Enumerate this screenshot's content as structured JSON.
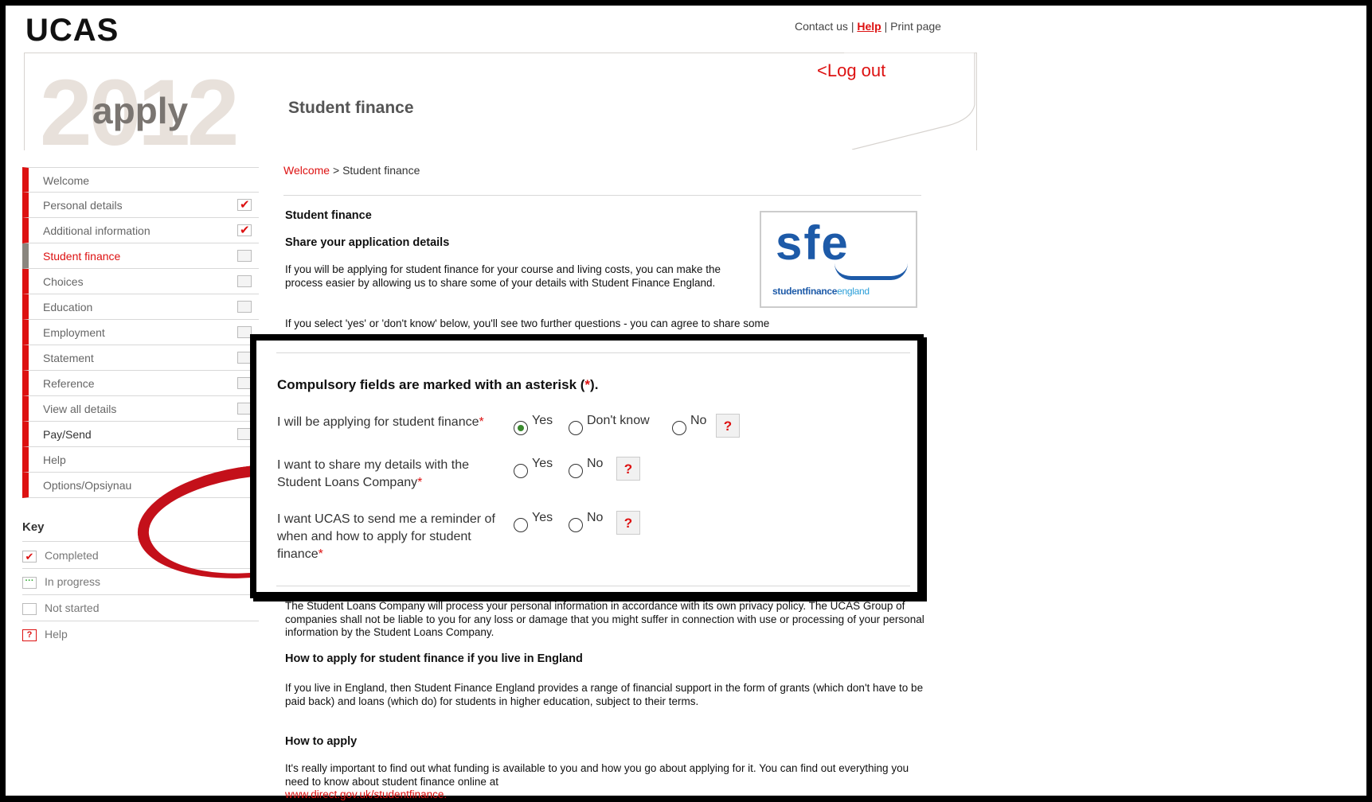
{
  "logo": "UCAS",
  "top_links": {
    "contact": "Contact us",
    "sep1": " | ",
    "help": "Help",
    "sep2": " | ",
    "print": "Print page"
  },
  "header": {
    "year": "2012",
    "product": "apply",
    "section": "Student finance",
    "logout": "<Log out"
  },
  "sidebar": {
    "items": [
      {
        "label": "Welcome",
        "status": "none"
      },
      {
        "label": "Personal details",
        "status": "completed"
      },
      {
        "label": "Additional information",
        "status": "completed"
      },
      {
        "label": "Student finance",
        "status": "not_started",
        "active": true
      },
      {
        "label": "Choices",
        "status": "not_started"
      },
      {
        "label": "Education",
        "status": "not_started"
      },
      {
        "label": "Employment",
        "status": "not_started"
      },
      {
        "label": "Statement",
        "status": "not_started"
      },
      {
        "label": "Reference",
        "status": "not_started"
      },
      {
        "label": "View all details",
        "status": "not_started"
      },
      {
        "label": "Pay/Send",
        "status": "not_started"
      },
      {
        "label": "Help",
        "status": "none"
      },
      {
        "label": "Options/Opsiynau",
        "status": "none"
      }
    ]
  },
  "key": {
    "title": "Key",
    "completed": "Completed",
    "in_progress": "In progress",
    "not_started": "Not started",
    "help": "Help"
  },
  "breadcrumb": {
    "home": "Welcome",
    "sep": " > ",
    "current": "Student finance"
  },
  "content": {
    "heading": "Student finance",
    "subheading": "Share your application details",
    "p1": "If you will be applying for student finance for your course and living costs, you can make the process easier by allowing us to share some of your details with Student Finance England.",
    "p2": "If you select 'yes' or 'don't know' below, you'll see two further questions - you can agree to share some",
    "p3": "The Student Loans Company will process your personal information in accordance with its own privacy policy. The UCAS Group of companies shall not be liable to you for any loss or damage that you might suffer in connection with use or processing of your personal information by the Student Loans Company.",
    "h_england": "How to apply for student finance if you live in England",
    "p4": "If you live in England, then Student Finance England provides a range of financial support in the form of grants (which don't have to be paid back) and loans (which do) for students in higher education, subject to their terms.",
    "h_how": "How to apply",
    "p5": "It's really important to find out what funding is available to you and how you go about applying for it. You can find out everything you need to know about student finance online at",
    "link": "www.direct.gov.uk/studentfinance."
  },
  "sfe_logo": {
    "big": "sfe",
    "small_a": "studentfinance",
    "small_b": "england"
  },
  "form": {
    "title_prefix": "Compulsory fields are marked with an asterisk (",
    "asterisk": "*",
    "title_suffix": ").",
    "q1": {
      "label": "I will be applying for student finance",
      "options": [
        "Yes",
        "Don't know",
        "No"
      ],
      "selected": "Yes"
    },
    "q2": {
      "label": "I want to share my details with the Student Loans Company",
      "options": [
        "Yes",
        "No"
      ],
      "selected": ""
    },
    "q3": {
      "label": "I want UCAS to send me a reminder of when and how to apply for student finance",
      "options": [
        "Yes",
        "No"
      ],
      "selected": ""
    },
    "help_glyph": "?"
  },
  "colors": {
    "accent": "#dd1111",
    "sfe_blue": "#1d5aa8",
    "radio_selected": "#3a8a2e"
  }
}
